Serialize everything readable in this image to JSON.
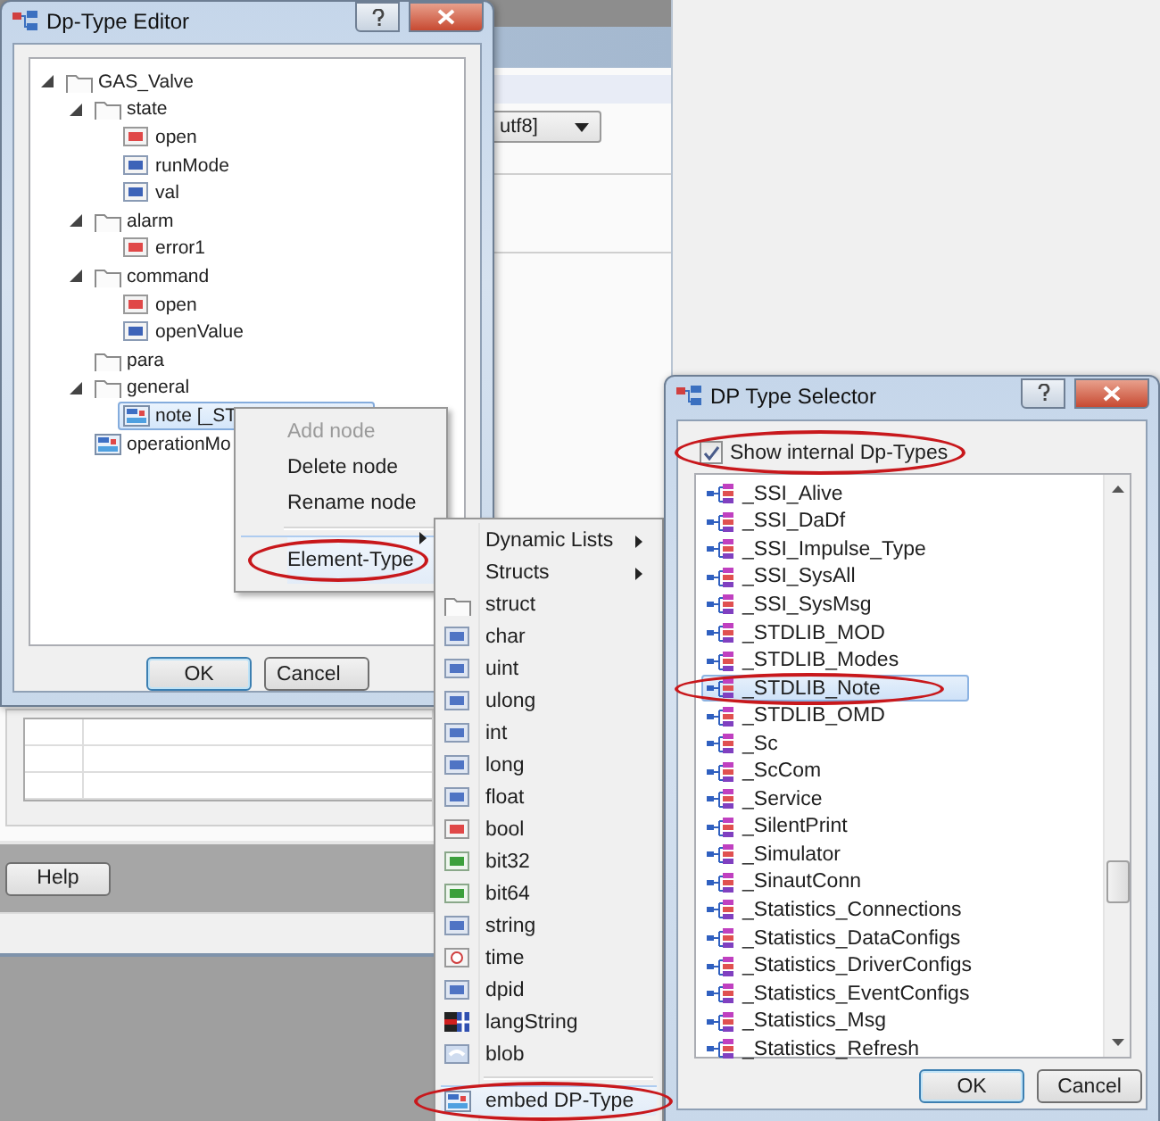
{
  "background_window": {
    "combo_value": "utf8]",
    "help_button": "Help"
  },
  "dp_type_editor": {
    "title": "Dp-Type Editor",
    "tree": [
      {
        "label": "GAS_Valve",
        "kind": "folder",
        "selected": false,
        "expanded": true,
        "children": [
          {
            "label": "state",
            "kind": "folder",
            "selected": false,
            "expanded": true,
            "children": [
              {
                "label": "open",
                "kind": "bool",
                "selected": false
              },
              {
                "label": "runMode",
                "kind": "int",
                "selected": false
              },
              {
                "label": "val",
                "kind": "float",
                "selected": false
              }
            ]
          },
          {
            "label": "alarm",
            "kind": "folder",
            "selected": false,
            "expanded": true,
            "children": [
              {
                "label": "error1",
                "kind": "bool",
                "selected": false
              }
            ]
          },
          {
            "label": "command",
            "kind": "folder",
            "selected": false,
            "expanded": true,
            "children": [
              {
                "label": "open",
                "kind": "bool",
                "selected": false
              },
              {
                "label": "openValue",
                "kind": "float",
                "selected": false
              }
            ]
          },
          {
            "label": "para",
            "kind": "folder",
            "selected": false
          },
          {
            "label": "general",
            "kind": "folder",
            "selected": false,
            "expanded": true,
            "children": [
              {
                "label": "note [_ST",
                "kind": "dptype",
                "selected": true
              }
            ]
          },
          {
            "label": "operationMo",
            "kind": "dptype",
            "selected": false
          }
        ]
      }
    ],
    "buttons": [
      {
        "label": "OK",
        "default": true
      },
      {
        "label": "Cancel",
        "default": false
      }
    ]
  },
  "context_menu": {
    "items": [
      {
        "label": "Add node",
        "disabled": true,
        "highlighted": false,
        "submenu": false,
        "separated": false,
        "circled": false
      },
      {
        "label": "Delete node",
        "disabled": false,
        "highlighted": false,
        "submenu": false,
        "separated": false,
        "circled": false
      },
      {
        "label": "Rename node",
        "disabled": false,
        "highlighted": false,
        "submenu": false,
        "separated": false,
        "circled": false
      },
      {
        "label": "Element-Type",
        "disabled": false,
        "highlighted": true,
        "submenu": true,
        "separated": true,
        "circled": true
      }
    ]
  },
  "element_type_menu": {
    "items": [
      {
        "label": "Dynamic Lists",
        "kind": "submenu",
        "highlighted": false,
        "separated": false,
        "circled": false
      },
      {
        "label": "Structs",
        "kind": "submenu",
        "highlighted": false,
        "separated": false,
        "circled": false
      },
      {
        "label": "struct",
        "kind": "folder",
        "highlighted": false,
        "separated": false,
        "circled": false
      },
      {
        "label": "char",
        "kind": "blue",
        "highlighted": false,
        "separated": false,
        "circled": false
      },
      {
        "label": "uint",
        "kind": "blue",
        "highlighted": false,
        "separated": false,
        "circled": false
      },
      {
        "label": "ulong",
        "kind": "blue",
        "highlighted": false,
        "separated": false,
        "circled": false
      },
      {
        "label": "int",
        "kind": "blue",
        "highlighted": false,
        "separated": false,
        "circled": false
      },
      {
        "label": "long",
        "kind": "blue",
        "highlighted": false,
        "separated": false,
        "circled": false
      },
      {
        "label": "float",
        "kind": "blue",
        "highlighted": false,
        "separated": false,
        "circled": false
      },
      {
        "label": "bool",
        "kind": "red",
        "highlighted": false,
        "separated": false,
        "circled": false
      },
      {
        "label": "bit32",
        "kind": "green",
        "highlighted": false,
        "separated": false,
        "circled": false
      },
      {
        "label": "bit64",
        "kind": "green",
        "highlighted": false,
        "separated": false,
        "circled": false
      },
      {
        "label": "string",
        "kind": "blue",
        "highlighted": false,
        "separated": false,
        "circled": false
      },
      {
        "label": "time",
        "kind": "time",
        "highlighted": false,
        "separated": false,
        "circled": false
      },
      {
        "label": "dpid",
        "kind": "blue",
        "highlighted": false,
        "separated": false,
        "circled": false
      },
      {
        "label": "langString",
        "kind": "flag",
        "highlighted": false,
        "separated": false,
        "circled": false
      },
      {
        "label": "blob",
        "kind": "blob",
        "highlighted": false,
        "separated": false,
        "circled": false
      },
      {
        "label": "embed DP-Type",
        "kind": "dptype",
        "highlighted": true,
        "separated": true,
        "circled": true
      }
    ]
  },
  "dp_type_selector": {
    "title": "DP Type Selector",
    "show_internal": {
      "label": "Show internal Dp-Types",
      "checked": true,
      "circled": true
    },
    "types": [
      {
        "label": "_SSI_Alive",
        "selected": false,
        "circled": false
      },
      {
        "label": "_SSI_DaDf",
        "selected": false,
        "circled": false
      },
      {
        "label": "_SSI_Impulse_Type",
        "selected": false,
        "circled": false
      },
      {
        "label": "_SSI_SysAll",
        "selected": false,
        "circled": false
      },
      {
        "label": "_SSI_SysMsg",
        "selected": false,
        "circled": false
      },
      {
        "label": "_STDLIB_MOD",
        "selected": false,
        "circled": false
      },
      {
        "label": "_STDLIB_Modes",
        "selected": false,
        "circled": false
      },
      {
        "label": "_STDLIB_Note",
        "selected": true,
        "circled": true
      },
      {
        "label": "_STDLIB_OMD",
        "selected": false,
        "circled": false
      },
      {
        "label": "_Sc",
        "selected": false,
        "circled": false
      },
      {
        "label": "_ScCom",
        "selected": false,
        "circled": false
      },
      {
        "label": "_Service",
        "selected": false,
        "circled": false
      },
      {
        "label": "_SilentPrint",
        "selected": false,
        "circled": false
      },
      {
        "label": "_Simulator",
        "selected": false,
        "circled": false
      },
      {
        "label": "_SinautConn",
        "selected": false,
        "circled": false
      },
      {
        "label": "_Statistics_Connections",
        "selected": false,
        "circled": false
      },
      {
        "label": "_Statistics_DataConfigs",
        "selected": false,
        "circled": false
      },
      {
        "label": "_Statistics_DriverConfigs",
        "selected": false,
        "circled": false
      },
      {
        "label": "_Statistics_EventConfigs",
        "selected": false,
        "circled": false
      },
      {
        "label": "_Statistics_Msg",
        "selected": false,
        "circled": false
      },
      {
        "label": "_Statistics_Refresh",
        "selected": false,
        "circled": false
      }
    ],
    "buttons": [
      {
        "label": "OK",
        "default": true
      },
      {
        "label": "Cancel",
        "default": false
      }
    ]
  }
}
